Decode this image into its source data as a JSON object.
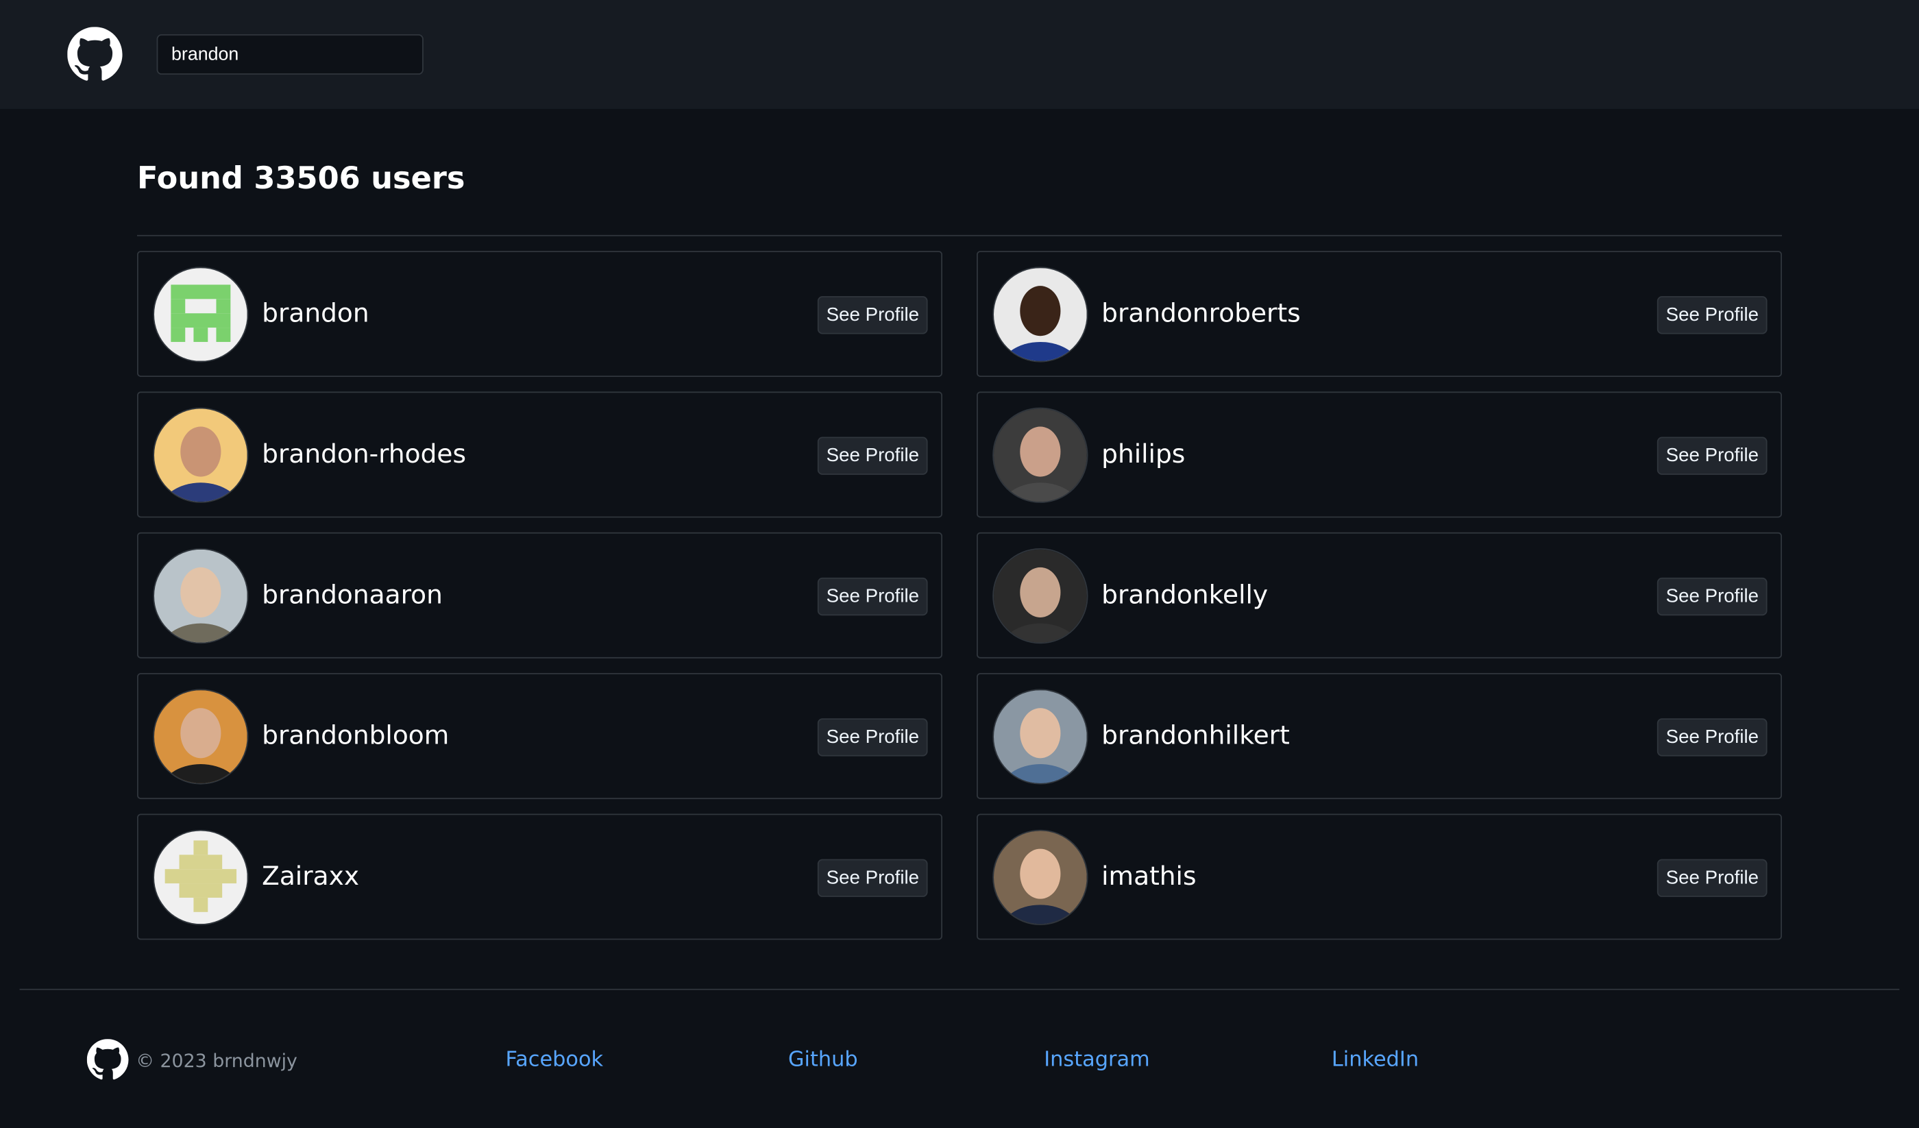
{
  "header": {
    "logo_icon": "github-octocat-icon",
    "search": {
      "value": "brandon"
    }
  },
  "results": {
    "heading": "Found 33506 users",
    "button_label": "See Profile",
    "users": [
      {
        "login": "brandon",
        "avatar": "green-identicon"
      },
      {
        "login": "brandonroberts",
        "avatar": "photo"
      },
      {
        "login": "brandon-rhodes",
        "avatar": "photo"
      },
      {
        "login": "philips",
        "avatar": "photo"
      },
      {
        "login": "brandonaaron",
        "avatar": "photo"
      },
      {
        "login": "brandonkelly",
        "avatar": "photo"
      },
      {
        "login": "brandonbloom",
        "avatar": "photo"
      },
      {
        "login": "brandonhilkert",
        "avatar": "photo"
      },
      {
        "login": "Zairaxx",
        "avatar": "khaki-identicon"
      },
      {
        "login": "imathis",
        "avatar": "photo"
      }
    ]
  },
  "footer": {
    "logo_icon": "github-octocat-icon",
    "copyright": "© 2023 brndnwjy",
    "links": [
      "Facebook",
      "Github",
      "Instagram",
      "LinkedIn"
    ],
    "link_color": "#58a6ff"
  }
}
